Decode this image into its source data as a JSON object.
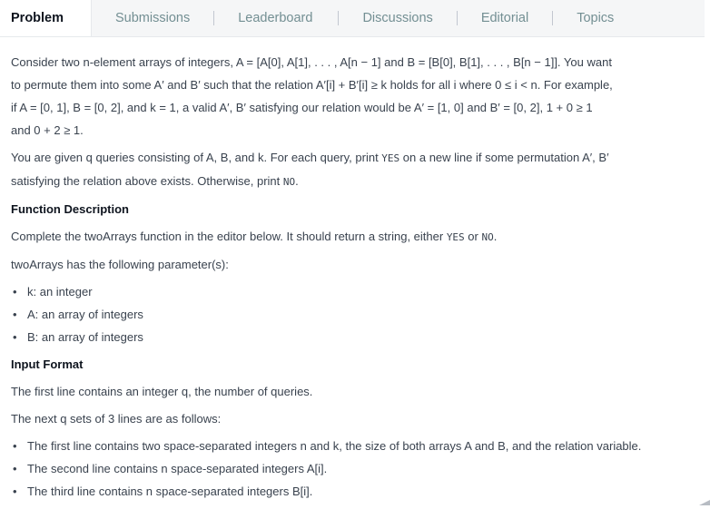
{
  "tabs": [
    {
      "label": "Problem"
    },
    {
      "label": "Submissions"
    },
    {
      "label": "Leaderboard"
    },
    {
      "label": "Discussions"
    },
    {
      "label": "Editorial"
    },
    {
      "label": "Topics"
    }
  ],
  "statement": {
    "line1": "Consider two n-element arrays of integers, A = [A[0], A[1], . . . , A[n − 1] and B = [B[0], B[1], . . . , B[n − 1]]. You want",
    "line2": "to permute them into some A′ and B′ such that the relation A′[i] + B′[i] ≥ k holds for all i where 0 ≤ i < n. For example,",
    "line3": "if A = [0, 1], B = [0, 2], and k = 1, a valid A′, B′ satisfying our relation would be A′ = [1, 0] and B′ = [0, 2], 1 + 0 ≥ 1",
    "line4": "and 0 + 2 ≥ 1."
  },
  "queries": {
    "line1_a": "You are given q queries consisting of A, B, and k. For each query, print ",
    "yes": "YES",
    "line1_b": " on a new line if some permutation A′, B′",
    "line2_a": "satisfying the relation above exists. Otherwise, print ",
    "no": "NO",
    "line2_b": "."
  },
  "function_description": {
    "heading": "Function Description",
    "text_a": "Complete the twoArrays function in the editor below. It should return a string, either ",
    "yes": "YES",
    "text_b": " or ",
    "no": "NO",
    "text_c": ".",
    "params_label": "twoArrays has the following parameter(s):",
    "params": [
      "k: an integer",
      "A: an array of integers",
      "B: an array of integers"
    ]
  },
  "input_format": {
    "heading": "Input Format",
    "line1": "The first line contains an integer q, the number of queries.",
    "line2": "The next q sets of 3 lines are as follows:",
    "items": [
      "The first line contains two space-separated integers n and k, the size of both arrays A and B, and the relation variable.",
      "The second line contains n space-separated integers A[i].",
      "The third line contains n space-separated integers B[i]."
    ]
  }
}
